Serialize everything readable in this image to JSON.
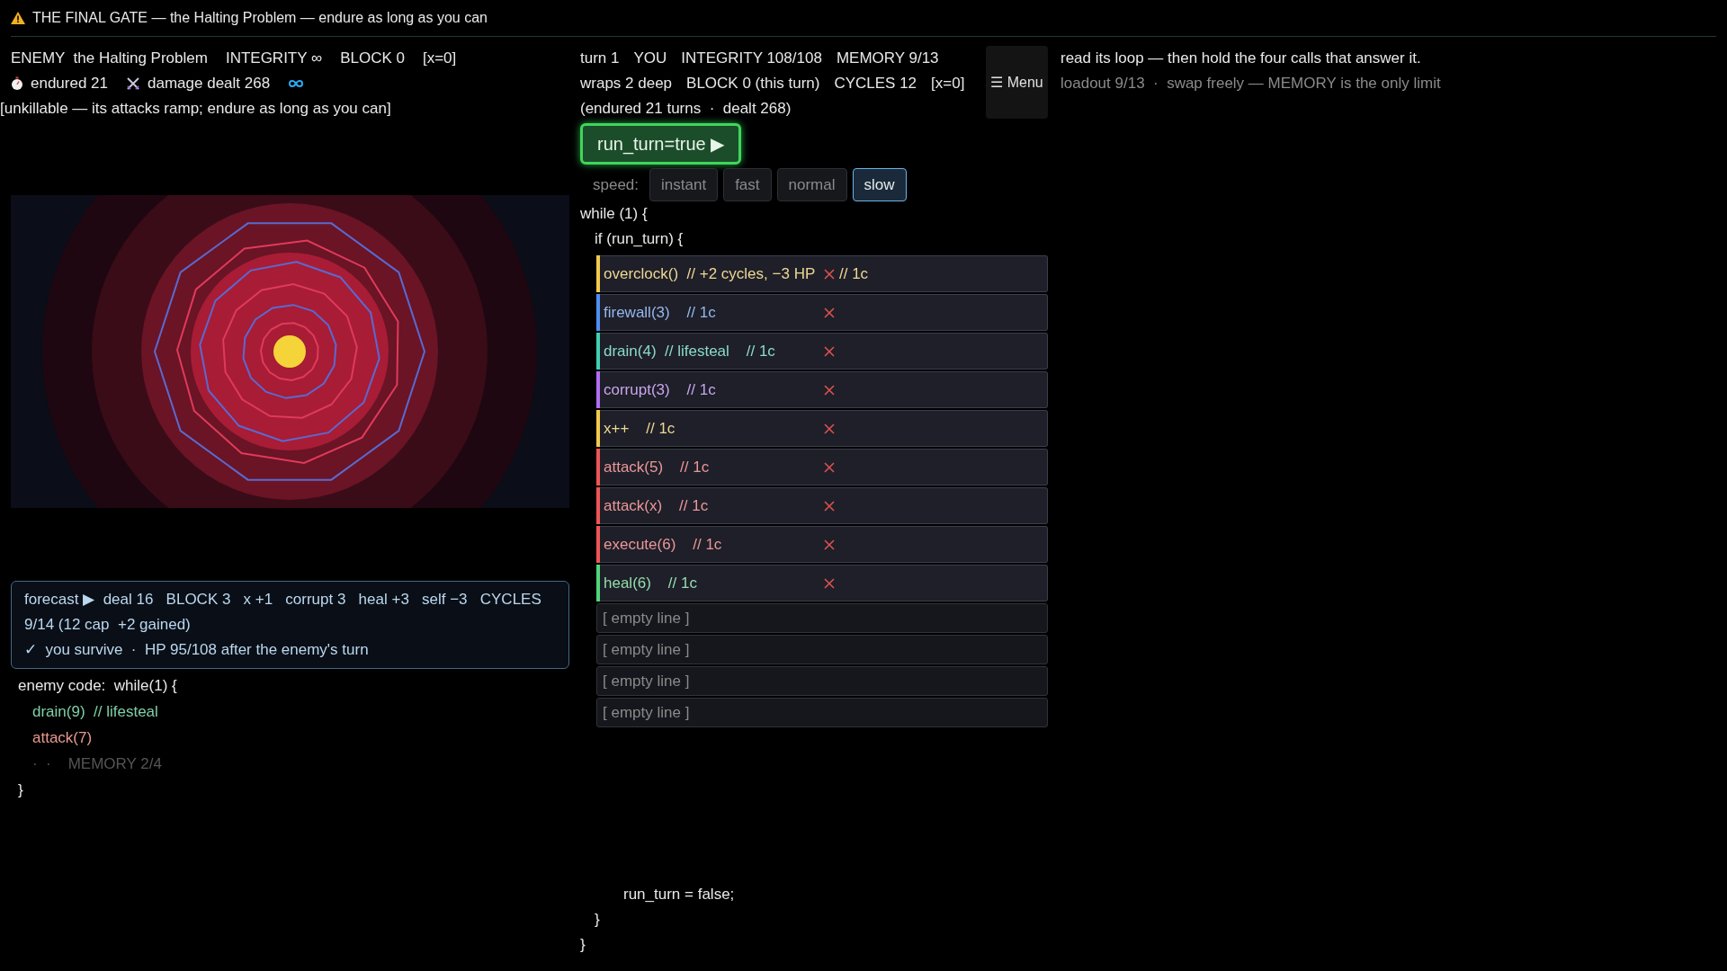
{
  "title": "THE FINAL GATE — the Halting Problem — endure as long as you can",
  "enemy": {
    "stats": [
      "ENEMY  the Halting Problem",
      "INTEGRITY ∞",
      "BLOCK 0",
      "[x=0]"
    ],
    "endured": "endured 21",
    "damage": "damage dealt 268",
    "note": "[unkillable — its attacks ramp; endure as long as you can]"
  },
  "player": {
    "lines": [
      [
        "turn 1",
        "YOU",
        "INTEGRITY 108/108",
        "MEMORY 9/13"
      ],
      [
        "wraps 2 deep",
        "BLOCK 0 (this turn)",
        "CYCLES 12",
        "[x=0]"
      ],
      [
        "(endured 21 turns  ·  dealt 268)"
      ]
    ]
  },
  "menu": "☰ Menu",
  "run_button": "run_turn=true ▶",
  "speed": {
    "label": "speed:",
    "options": [
      {
        "label": "instant",
        "selected": false
      },
      {
        "label": "fast",
        "selected": false
      },
      {
        "label": "normal",
        "selected": false
      },
      {
        "label": "slow",
        "selected": true
      }
    ]
  },
  "code_open": [
    "while (1) {",
    "if (run_turn) {"
  ],
  "lines": [
    {
      "kind": "call",
      "code": "overclock()  // +2 cycles, −3 HP",
      "tail": "// 1c",
      "color": "#f2c94c"
    },
    {
      "kind": "call",
      "code": "firewall(3)    // 1c",
      "color": "#4f8ff0"
    },
    {
      "kind": "call",
      "code": "drain(4)  // lifesteal    // 1c",
      "color": "#3fd0b0"
    },
    {
      "kind": "call",
      "code": "corrupt(3)    // 1c",
      "color": "#b06ef0"
    },
    {
      "kind": "call",
      "code": "x++    // 1c",
      "color": "#f2c94c"
    },
    {
      "kind": "call",
      "code": "attack(5)    // 1c",
      "color": "#ee5555"
    },
    {
      "kind": "call",
      "code": "attack(x)    // 1c",
      "color": "#ee5555"
    },
    {
      "kind": "call",
      "code": "execute(6)    // 1c",
      "color": "#ee5555"
    },
    {
      "kind": "call",
      "code": "heal(6)    // 1c",
      "color": "#4fd67a"
    },
    {
      "kind": "empty",
      "code": "[ empty line ]"
    },
    {
      "kind": "empty",
      "code": "[ empty line ]"
    },
    {
      "kind": "empty",
      "code": "[ empty line ]"
    },
    {
      "kind": "empty",
      "code": "[ empty line ]"
    }
  ],
  "code_close": [
    "run_turn = false;",
    "}",
    "}"
  ],
  "forecast": {
    "summary": "forecast ▶  deal 16   BLOCK 3   x +1   corrupt 3   heal +3   self −3   CYCLES 9/14 (12 cap  +2 gained)",
    "verdict": "✓  you survive  ·  HP 95/108 after the enemy's turn"
  },
  "enemy_code": {
    "header": "enemy code:  while(1) {",
    "lines": [
      {
        "text": "drain(9)  // lifesteal",
        "color": "#7fd0a8"
      },
      {
        "text": "attack(7)",
        "color": "#e89a90"
      }
    ],
    "memory": "·  ·    MEMORY 2/4",
    "close": "}"
  },
  "hint": {
    "text": "read its loop — then hold the four calls that answer it.",
    "sub": "loadout 9/13  ·  swap freely — MEMORY is the only limit"
  }
}
